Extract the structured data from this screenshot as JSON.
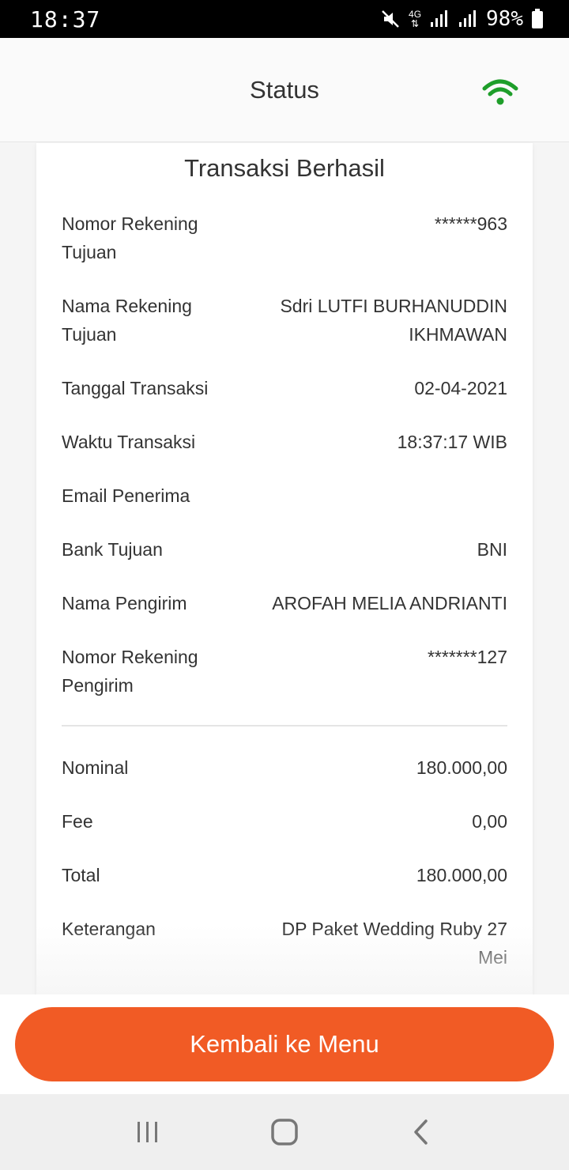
{
  "status_bar": {
    "time": "18:37",
    "network": "4G",
    "battery": "98%"
  },
  "header": {
    "title": "Status"
  },
  "receipt": {
    "title": "Transaksi Berhasil",
    "details": [
      {
        "label": "Nomor Rekening Tujuan",
        "value": "******963"
      },
      {
        "label": "Nama Rekening Tujuan",
        "value": "Sdri LUTFI BURHANUDDIN IKHMAWAN"
      },
      {
        "label": "Tanggal Transaksi",
        "value": "02-04-2021"
      },
      {
        "label": "Waktu Transaksi",
        "value": "18:37:17 WIB"
      },
      {
        "label": "Email Penerima",
        "value": ""
      },
      {
        "label": "Bank Tujuan",
        "value": "BNI"
      },
      {
        "label": "Nama Pengirim",
        "value": "AROFAH MELIA ANDRIANTI"
      },
      {
        "label": "Nomor Rekening Pengirim",
        "value": "*******127"
      }
    ],
    "amounts": [
      {
        "label": "Nominal",
        "value": "180.000,00"
      },
      {
        "label": "Fee",
        "value": "0,00"
      },
      {
        "label": "Total",
        "value": "180.000,00"
      },
      {
        "label": "Keterangan",
        "value": "DP Paket Wedding Ruby 27 Mei"
      }
    ]
  },
  "actions": {
    "back_label": "Kembali ke Menu"
  },
  "colors": {
    "accent": "#f15b25",
    "wifi_connected": "#1e9e2a"
  },
  "icons": {
    "wifi": "wifi-icon",
    "mute": "mute-icon",
    "signal": "signal-icon",
    "battery": "battery-icon",
    "nav_recents": "recents-icon",
    "nav_home": "home-icon",
    "nav_back": "back-icon"
  }
}
